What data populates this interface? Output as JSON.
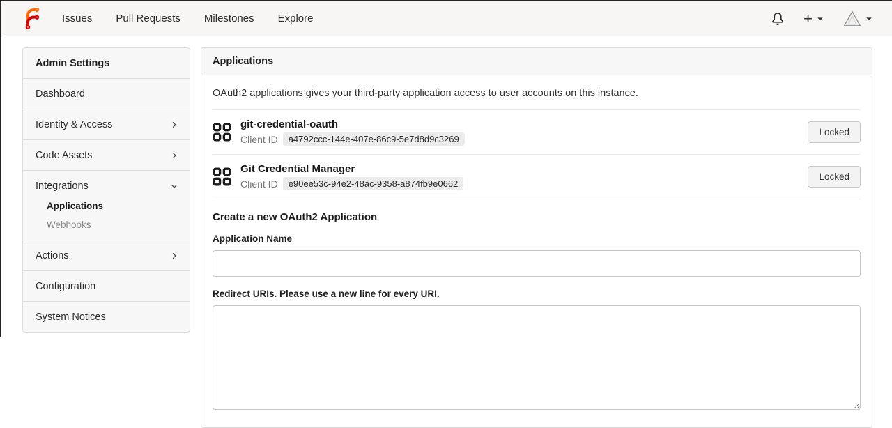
{
  "colors": {
    "logo_orange": "#ff6600",
    "logo_red": "#d40000",
    "navbar_bg": "#f7f6f5",
    "panel_border": "#dcdcdc"
  },
  "navbar": {
    "links": [
      {
        "label": "Issues"
      },
      {
        "label": "Pull Requests"
      },
      {
        "label": "Milestones"
      },
      {
        "label": "Explore"
      }
    ],
    "icons": [
      "bell-icon",
      "plus-icon",
      "avatar-triangle"
    ]
  },
  "sidebar": {
    "title": "Admin Settings",
    "items": [
      {
        "label": "Dashboard"
      },
      {
        "label": "Identity & Access",
        "chevron": "right"
      },
      {
        "label": "Code Assets",
        "chevron": "right"
      },
      {
        "label": "Integrations",
        "chevron": "down"
      },
      {
        "label": "Actions",
        "chevron": "right"
      },
      {
        "label": "Configuration"
      },
      {
        "label": "System Notices"
      }
    ],
    "integrations_children": [
      {
        "label": "Applications",
        "active": true
      },
      {
        "label": "Webhooks",
        "active": false
      }
    ]
  },
  "main": {
    "panel_title": "Applications",
    "description": "OAuth2 applications gives your third-party application access to user accounts on this instance.",
    "apps": [
      {
        "name": "git-credential-oauth",
        "client_id_label": "Client ID",
        "client_id": "a4792ccc-144e-407e-86c9-5e7d8d9c3269",
        "locked_label": "Locked"
      },
      {
        "name": "Git Credential Manager",
        "client_id_label": "Client ID",
        "client_id": "e90ee53c-94e2-48ac-9358-a874fb9e0662",
        "locked_label": "Locked"
      }
    ],
    "create_section": {
      "title": "Create a new OAuth2 Application",
      "app_name_label": "Application Name",
      "app_name_value": "",
      "redirect_uri_label": "Redirect URIs. Please use a new line for every URI.",
      "redirect_uri_value": ""
    }
  }
}
